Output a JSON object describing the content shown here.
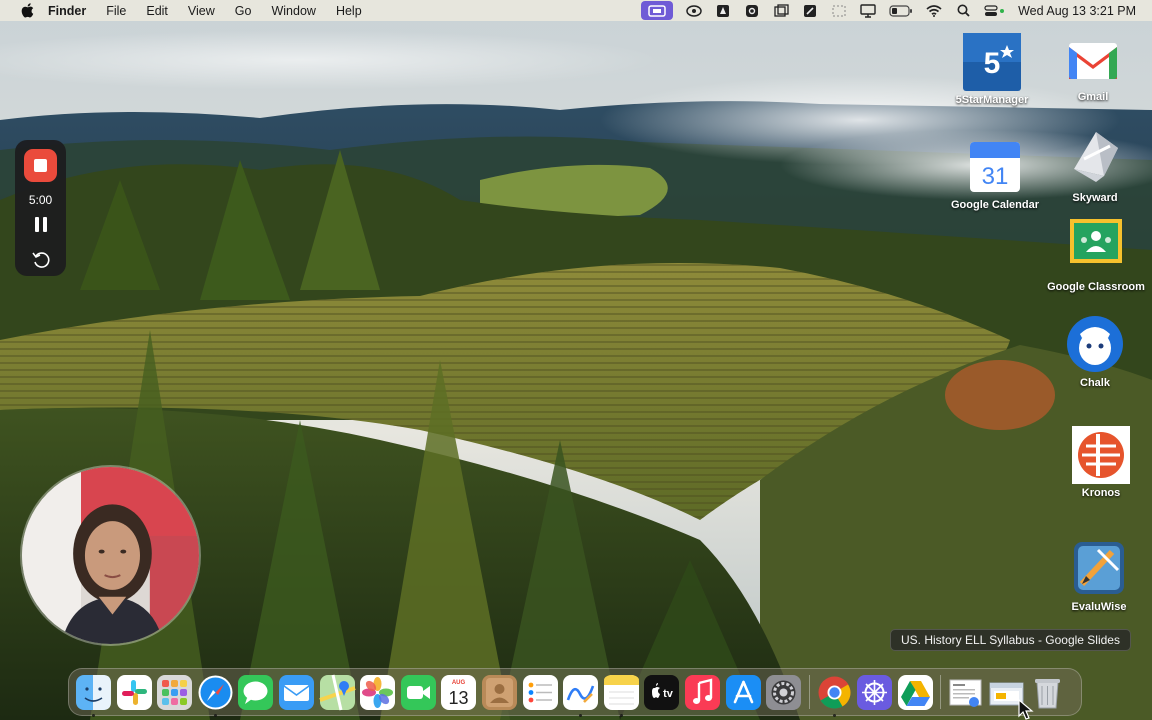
{
  "menubar": {
    "app_name": "Finder",
    "menus": [
      "File",
      "Edit",
      "View",
      "Go",
      "Window",
      "Help"
    ],
    "status_icons": [
      "screen-recorder-icon",
      "creative-cloud-icon",
      "notification-icon",
      "settings-gear-icon",
      "window-icon",
      "screenshot-icon",
      "dashed-box-icon",
      "display-icon",
      "battery-icon",
      "wifi-icon",
      "search-icon",
      "control-center-icon"
    ],
    "clock": "Wed Aug 13  3:21 PM"
  },
  "recorder": {
    "time": "5:00"
  },
  "desktop_icons": [
    {
      "label": "5StarManager",
      "icon": "five-star-manager-icon"
    },
    {
      "label": "Gmail",
      "icon": "gmail-icon"
    },
    {
      "label": "Google Calendar",
      "icon": "google-calendar-icon",
      "day": "31"
    },
    {
      "label": "Skyward",
      "icon": "skyward-icon"
    },
    {
      "label": "Google Classroom",
      "icon": "google-classroom-icon"
    },
    {
      "label": "Chalk",
      "icon": "chalk-icon"
    },
    {
      "label": "Kronos",
      "icon": "kronos-icon"
    },
    {
      "label": "EvaluWise",
      "icon": "evaluwise-icon"
    }
  ],
  "tooltip": "US. History ELL Syllabus - Google Slides",
  "dock": {
    "calendar_month": "AUG",
    "calendar_day": "13",
    "apple_tv_label": "tv",
    "items": [
      "finder",
      "slack",
      "launchpad",
      "safari",
      "messages",
      "mail",
      "maps",
      "photos",
      "facetime",
      "calendar",
      "contacts",
      "reminders",
      "freeform",
      "notes",
      "apple-tv",
      "music",
      "app-store",
      "system-settings",
      "chrome",
      "perplexity",
      "google-drive",
      "recent-document",
      "recent-window",
      "trash"
    ]
  },
  "colors": {
    "recorder_stop": "#ea4b3c",
    "status_active": "#6f5bd6"
  }
}
